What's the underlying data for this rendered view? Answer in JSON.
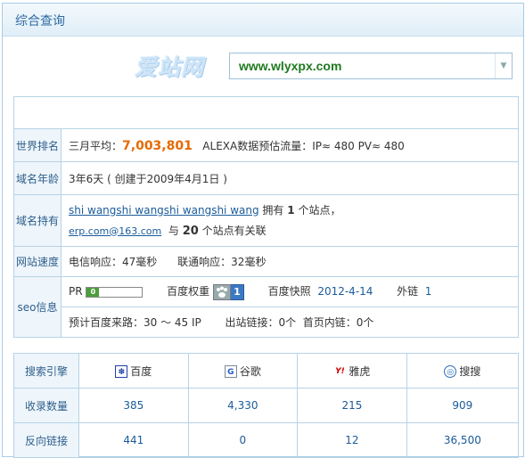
{
  "title": "综合查询",
  "logo_text": "爱站网",
  "domain_input": "www.wlyxpx.com",
  "rows": {
    "world_rank": {
      "label": "世界排名",
      "prefix": "三月平均：",
      "value": "7,003,801",
      "alexa": "ALEXA数据预估流量：IP≈ 480 PV≈ 480"
    },
    "domain_age": {
      "label": "域名年龄",
      "text": "3年6天 ( 创建于2009年4月1日 )"
    },
    "domain_owner": {
      "label": "域名持有",
      "owner_name": "shi wangshi wangshi wangshi wang",
      "owns": "拥有",
      "owns_count": "1",
      "owns_suffix": "个站点，",
      "email": "erp.com@163.com",
      "with": "与",
      "related_count": "20",
      "related_suffix": "个站点有关联"
    },
    "speed": {
      "label": "网站速度",
      "telecom": "电信响应：47毫秒",
      "unicom": "联通响应：32毫秒"
    },
    "seo": {
      "label": "seo信息",
      "pr_label": "PR",
      "pr_value": "0",
      "pr_fraction": 0,
      "baidu_weight_label": "百度权重",
      "baidu_weight_value": "1",
      "snapshot_label": "百度快照",
      "snapshot_value": "2012-4-14",
      "backlinks_label": "外链",
      "backlinks_value": "1",
      "estimated_visits": "预计百度来路：30 ～ 45 IP",
      "outbound_links": "出站链接：0个",
      "homepage_internal": "首页内链：0个"
    }
  },
  "engines_table": {
    "header_label": "搜索引擎",
    "engines": [
      {
        "name": "百度",
        "icon": "baidu-icon"
      },
      {
        "name": "谷歌",
        "icon": "google-icon"
      },
      {
        "name": "雅虎",
        "icon": "yahoo-icon"
      },
      {
        "name": "搜搜",
        "icon": "soso-icon"
      }
    ],
    "indexed_label": "收录数量",
    "indexed": [
      "385",
      "4,330",
      "215",
      "909"
    ],
    "backlinks_label": "反向链接",
    "backlinks": [
      "441",
      "0",
      "12",
      "36,500"
    ]
  }
}
